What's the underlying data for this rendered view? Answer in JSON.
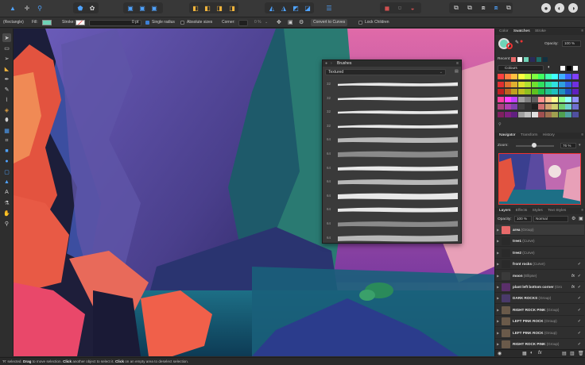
{
  "context_bar": {
    "selection": "(Rectangle)",
    "fill_label": "Fill:",
    "stroke_label": "Stroke:",
    "stroke_width": "0 pt",
    "single_radius": "Single radius",
    "absolute_sizes": "Absolute sizes",
    "corner_label": "Corner:",
    "corner_value": "0 %",
    "convert_to_curves": "Convert to Curves",
    "lock_children": "Lock Children"
  },
  "brushes": {
    "title": "Brushes",
    "category": "Textured",
    "sizes": [
      "32",
      "32",
      "32",
      "32",
      "64",
      "64",
      "64",
      "64",
      "64",
      "64",
      "64",
      "64"
    ]
  },
  "right_panel": {
    "tabs_top": [
      "Color",
      "Swatches",
      "Stroke"
    ],
    "opacity_label": "Opacity:",
    "opacity_value": "100 %",
    "recent_label": "Recent:",
    "palette_name": "Colours",
    "navigator_tabs": [
      "Navigator",
      "Transform",
      "History"
    ],
    "zoom_label": "Zoom:",
    "zoom_value": "76 %",
    "layers_tabs": [
      "Layers",
      "Effects",
      "Styles",
      "Text Styles"
    ],
    "layers_opacity_label": "Opacity:",
    "layers_opacity_value": "100 %",
    "blend_mode": "Normal",
    "layers": [
      {
        "name": "area",
        "type": "(Group)",
        "color": "#e86a6a",
        "fx": false,
        "check": false
      },
      {
        "name": "tree1",
        "type": "(Curve)",
        "color": "#2a2a2a",
        "fx": false,
        "check": false
      },
      {
        "name": "tree2",
        "type": "(Curve)",
        "color": "#2a2a2a",
        "fx": false,
        "check": false
      },
      {
        "name": "front rocks",
        "type": "(Curve)",
        "color": "#2a2a2a",
        "fx": false,
        "check": true
      },
      {
        "name": "moon",
        "type": "(Ellipse)",
        "color": "#3a3a3a",
        "fx": true,
        "check": true
      },
      {
        "name": "plant left bottom corner",
        "type": "(Gro",
        "color": "#5a2f6a",
        "fx": true,
        "check": true
      },
      {
        "name": "DARK ROCKS",
        "type": "(Group)",
        "color": "#4a3a6a",
        "fx": false,
        "check": true
      },
      {
        "name": "RIGHT ROCK PINK",
        "type": "(Group)",
        "color": "#6a5a4a",
        "fx": false,
        "check": true
      },
      {
        "name": "LEFT PINK ROCK",
        "type": "(Group)",
        "color": "#6a5a4a",
        "fx": false,
        "check": true
      },
      {
        "name": "LEFT PINK ROCK",
        "type": "(Group)",
        "color": "#6a5a4a",
        "fx": false,
        "check": true
      },
      {
        "name": "RIGHT ROCK PINK",
        "type": "(Group)",
        "color": "#6a5a4a",
        "fx": false,
        "check": true
      }
    ]
  },
  "status": {
    "t1": "'R' selected. ",
    "b1": "Drag",
    "t2": " to move selection. ",
    "b2": "Click",
    "t3": " another object to select it. ",
    "b3": "Click",
    "t4": " on an empty area to deselect selection."
  }
}
